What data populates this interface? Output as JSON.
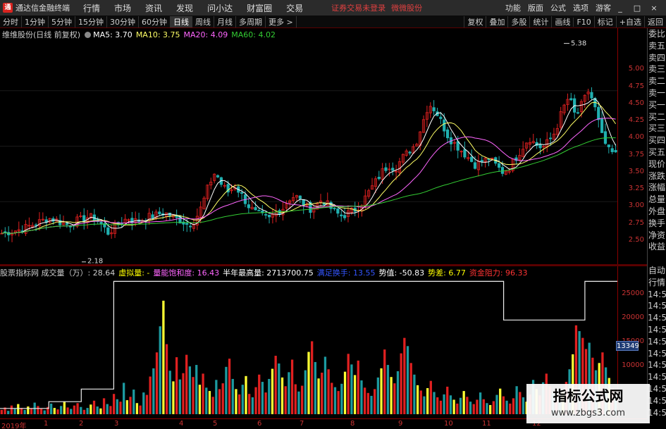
{
  "app": {
    "title": "通达信金融终端",
    "logo_char": "通",
    "menu": [
      "行情",
      "市场",
      "资讯",
      "发现",
      "问小达",
      "财富圈",
      "交易"
    ],
    "notice": "证券交易未登录",
    "notice2": "微微股份",
    "right_menu": [
      "功能",
      "版面",
      "公式",
      "选项"
    ],
    "guest": "游客",
    "window_controls": [
      "_",
      "□",
      "×"
    ]
  },
  "periods": [
    "分时",
    "1分钟",
    "5分钟",
    "15分钟",
    "30分钟",
    "60分钟",
    "日线",
    "周线",
    "月线",
    "多周期",
    "更多 >"
  ],
  "active_period": "日线",
  "tools": [
    "复权",
    "叠加",
    "多股",
    "统计",
    "画线",
    "F10",
    "标记",
    "+自选",
    "返回"
  ],
  "ma_legend": {
    "stock": "维维股份(日线 前复权)",
    "items": [
      {
        "label": "MA5: 3.70",
        "color": "#ffffff"
      },
      {
        "label": "MA10: 3.75",
        "color": "#ffff66"
      },
      {
        "label": "MA20: 4.09",
        "color": "#ff66ff"
      },
      {
        "label": "MA60: 4.02",
        "color": "#33cc33"
      }
    ]
  },
  "price_axis": [
    "5.00",
    "4.75",
    "4.50",
    "4.25",
    "4.00",
    "3.75",
    "3.50",
    "3.25",
    "3.00",
    "2.75",
    "2.50"
  ],
  "price_annotations": {
    "high": "5.38",
    "low": "2.18"
  },
  "side_panel": [
    "委比",
    "卖五",
    "卖四",
    "卖三",
    "卖二",
    "卖一",
    "买一",
    "买二",
    "买三",
    "买四",
    "买五",
    "现价",
    "涨跌",
    "涨幅",
    "总量",
    "外盘",
    "换手",
    "净资",
    "收益",
    "",
    "自动",
    "行情",
    "14:50",
    "14:50",
    "14:50",
    "14:50",
    "14:50",
    "14:50",
    "14:50",
    "14:50",
    "14:50",
    "14:50",
    "14:50"
  ],
  "indicator_legend": [
    {
      "label": "股票指标网 成交量（万）: 28.64",
      "color": "#cccccc"
    },
    {
      "label": "虚拟量: -",
      "color": "#ffff00"
    },
    {
      "label": "量能饱和度: 16.43",
      "color": "#ff66ff"
    },
    {
      "label": "半年最高量: 2713700.75",
      "color": "#ffffff"
    },
    {
      "label": "满足换手: 13.55",
      "color": "#3355ff"
    },
    {
      "label": "势值: -50.83",
      "color": "#ffffff"
    },
    {
      "label": "势差: 6.77",
      "color": "#ffff00"
    },
    {
      "label": "资金阻力: 96.33",
      "color": "#ff3333"
    }
  ],
  "volume_axis": [
    "25000",
    "20000",
    "15000",
    "10000"
  ],
  "volume_badge": "13349",
  "date_axis": [
    "2019年",
    "1",
    "2",
    "3",
    "4",
    "5",
    "6",
    "7",
    "8",
    "9",
    "10",
    "11",
    "12"
  ],
  "watermark": {
    "line1": "指标公式网",
    "line2": "www.zbgs3.com"
  },
  "chart_data": {
    "type": "candlestick",
    "price_range": [
      2.25,
      5.5
    ],
    "volume_range": [
      0,
      28000
    ],
    "price_path": [
      2.6,
      2.62,
      2.64,
      2.66,
      2.7,
      2.74,
      2.78,
      2.82,
      2.8,
      2.75,
      2.72,
      2.78,
      2.8,
      2.84,
      2.82,
      2.72,
      2.6,
      2.7,
      2.78,
      2.82,
      2.78,
      2.8,
      2.84,
      2.86,
      2.9,
      2.88,
      2.82,
      2.78,
      2.72,
      2.8,
      3.0,
      3.3,
      3.5,
      3.3,
      3.2,
      3.3,
      3.15,
      3.0,
      2.9,
      2.85,
      2.8,
      2.9,
      2.95,
      3.1,
      3.15,
      3.05,
      2.95,
      3.0,
      3.1,
      3.0,
      2.9,
      2.85,
      2.9,
      2.95,
      3.05,
      3.2,
      3.35,
      3.5,
      3.6,
      3.55,
      3.7,
      3.8,
      3.9,
      4.2,
      4.5,
      4.4,
      4.2,
      4.0,
      3.9,
      3.8,
      3.7,
      3.6,
      3.65,
      3.7,
      3.6,
      3.5,
      3.55,
      3.7,
      3.85,
      4.0,
      3.9,
      3.85,
      3.95,
      4.1,
      4.4,
      4.6,
      4.3,
      4.5,
      4.7,
      4.4,
      4.0,
      3.8,
      3.75
    ],
    "ma_series": [
      {
        "name": "MA5",
        "value": 3.7
      },
      {
        "name": "MA10",
        "value": 3.75
      },
      {
        "name": "MA20",
        "value": 4.09
      },
      {
        "name": "MA60",
        "value": 4.02
      }
    ],
    "volume_step_line": [
      1200,
      1200,
      1200,
      2600,
      2600,
      5200,
      5200,
      27500,
      27500,
      27500,
      27500,
      27500,
      27500,
      27500,
      27500,
      27500,
      27500,
      27500,
      27500,
      27500,
      27500,
      27500,
      27500,
      27500,
      27500,
      27500,
      27500,
      27500,
      27500,
      27500,
      27500,
      19500,
      19500,
      19500,
      19500,
      19500,
      27500,
      27500,
      27500
    ],
    "volume_bars": [
      900,
      1400,
      700,
      1800,
      1100,
      2100,
      1300,
      900,
      1600,
      1200,
      2400,
      1700,
      1100,
      800,
      1500,
      2200,
      1300,
      1000,
      1700,
      2600,
      1400,
      1100,
      1800,
      2300,
      1500,
      900,
      1300,
      2000,
      2800,
      1600,
      1200,
      3300,
      2100,
      1700,
      4200,
      3100,
      2600,
      6500,
      2900,
      3600,
      5100,
      2300,
      1800,
      4500,
      4000,
      7800,
      9500,
      12800,
      18200,
      23500,
      14500,
      9000,
      6800,
      11800,
      7200,
      8500,
      12300,
      9900,
      7700,
      10200,
      6100,
      8400,
      5500,
      4800,
      3600,
      7100,
      5200,
      6400,
      9800,
      11500,
      7300,
      5200,
      4100,
      6100,
      7900,
      4200,
      3500,
      5600,
      8200,
      6700,
      4500,
      7300,
      9400,
      12100,
      10500,
      7600,
      5800,
      8700,
      11300,
      6200,
      4700,
      5900,
      9100,
      12900,
      15100,
      10800,
      7400,
      8600,
      11900,
      9300,
      6500,
      5600,
      4800,
      6300,
      8800,
      12500,
      10300,
      8100,
      11100,
      7000,
      5500,
      4400,
      3800,
      5200,
      7600,
      9500,
      13400,
      10200,
      7700,
      6400,
      8900,
      12600,
      15800,
      14100,
      10600,
      8200,
      6000,
      4900,
      3700,
      5400,
      6900,
      4600,
      3500,
      2800,
      4100,
      5700,
      3900,
      3000,
      2200,
      3400,
      4800,
      3600,
      2600,
      2100,
      3000,
      4500,
      3100,
      2300,
      1900,
      2700,
      4000,
      5300,
      3700,
      2800,
      2200,
      3300,
      5800,
      4600,
      3500,
      2600,
      4100,
      7100,
      5200,
      3900,
      6600,
      8400,
      5800,
      4300,
      3200,
      2500,
      4600,
      6700,
      9300,
      12400,
      18400,
      17200,
      15800,
      13500,
      14800,
      11700,
      9100,
      10600,
      12800,
      9700,
      7500,
      5400,
      3800
    ]
  }
}
